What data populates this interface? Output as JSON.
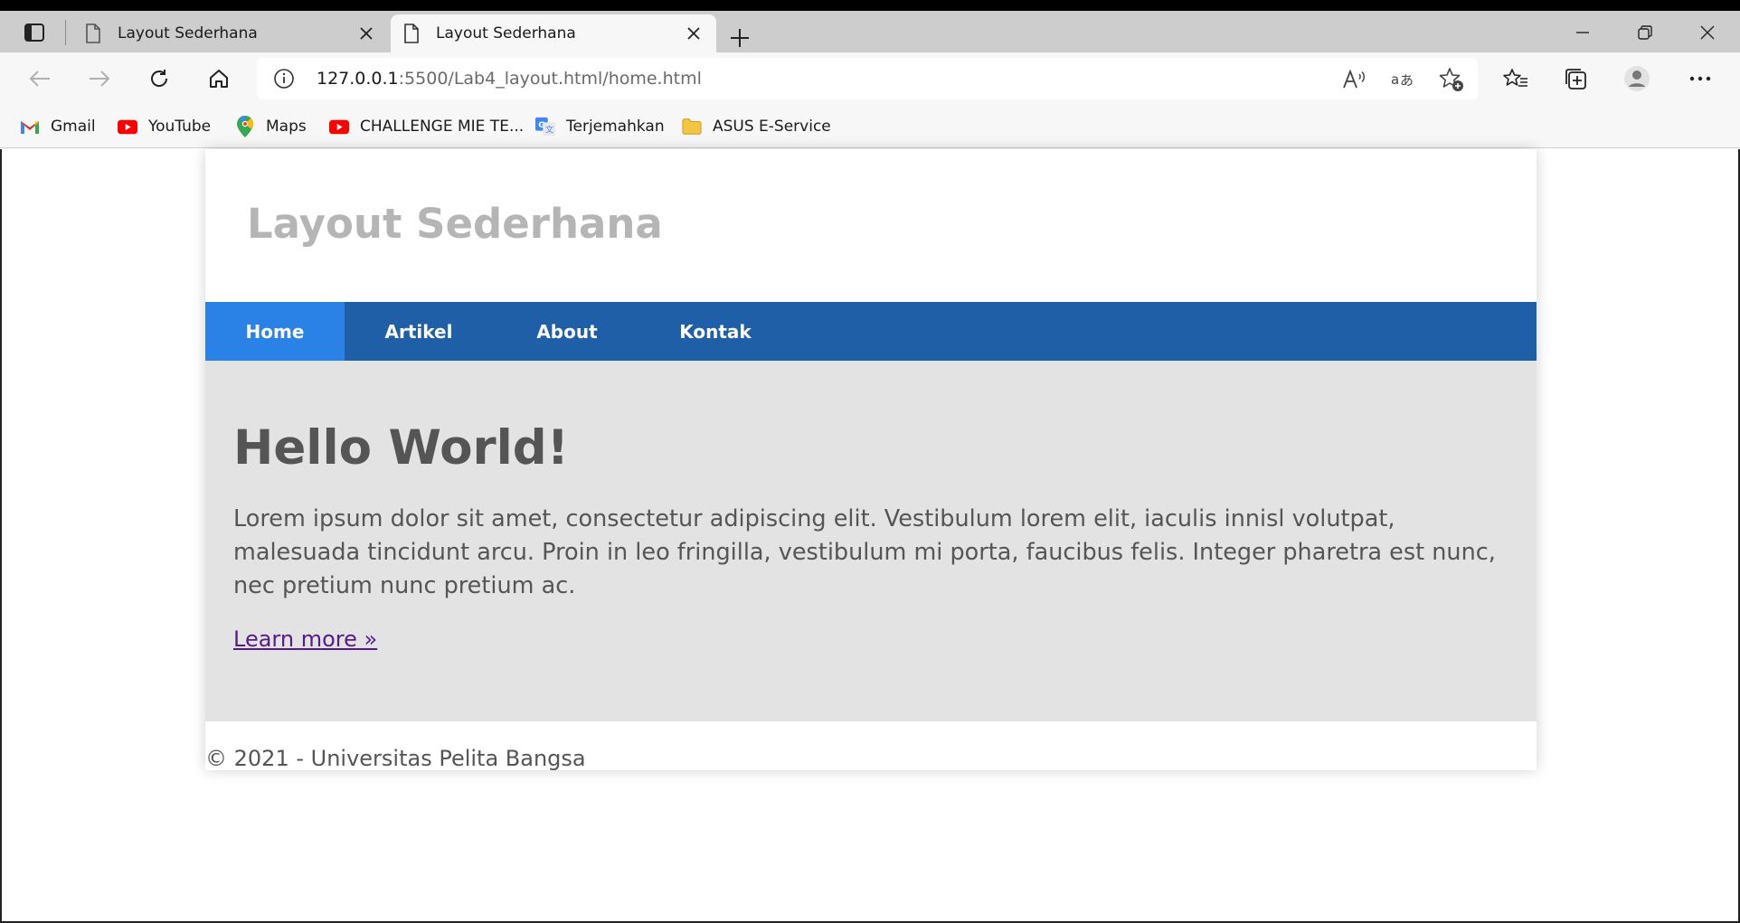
{
  "browser": {
    "tabs": [
      {
        "title": "Layout Sederhana",
        "active": false
      },
      {
        "title": "Layout Sederhana",
        "active": true
      }
    ],
    "url_host": "127.0.0.1",
    "url_rest": ":5500/Lab4_layout.html/home.html",
    "bookmarks": [
      {
        "label": "Gmail",
        "icon": "gmail-icon"
      },
      {
        "label": "YouTube",
        "icon": "youtube-icon"
      },
      {
        "label": "Maps",
        "icon": "maps-icon"
      },
      {
        "label": "CHALLENGE MIE TE...",
        "icon": "youtube-icon"
      },
      {
        "label": "Terjemahkan",
        "icon": "translate-icon"
      },
      {
        "label": "ASUS E-Service",
        "icon": "folder-icon"
      }
    ]
  },
  "page": {
    "site_title": "Layout Sederhana",
    "nav": [
      {
        "label": "Home",
        "active": true
      },
      {
        "label": "Artikel",
        "active": false
      },
      {
        "label": "About",
        "active": false
      },
      {
        "label": "Kontak",
        "active": false
      }
    ],
    "hero": {
      "heading": "Hello World!",
      "body": "Lorem ipsum dolor sit amet, consectetur adipiscing elit. Vestibulum lorem elit, iaculis innisl volutpat, malesuada tincidunt arcu. Proin in leo fringilla, vestibulum mi porta, faucibus felis. Integer pharetra est nunc, nec pretium nunc pretium ac.",
      "link": "Learn more »"
    },
    "footer": "© 2021 - Universitas Pelita Bangsa"
  },
  "colors": {
    "nav_bg": "#1f5fa8",
    "nav_active": "#2b82e6",
    "hero_bg": "#e3e3e3",
    "title_color": "#b5b5b5"
  }
}
